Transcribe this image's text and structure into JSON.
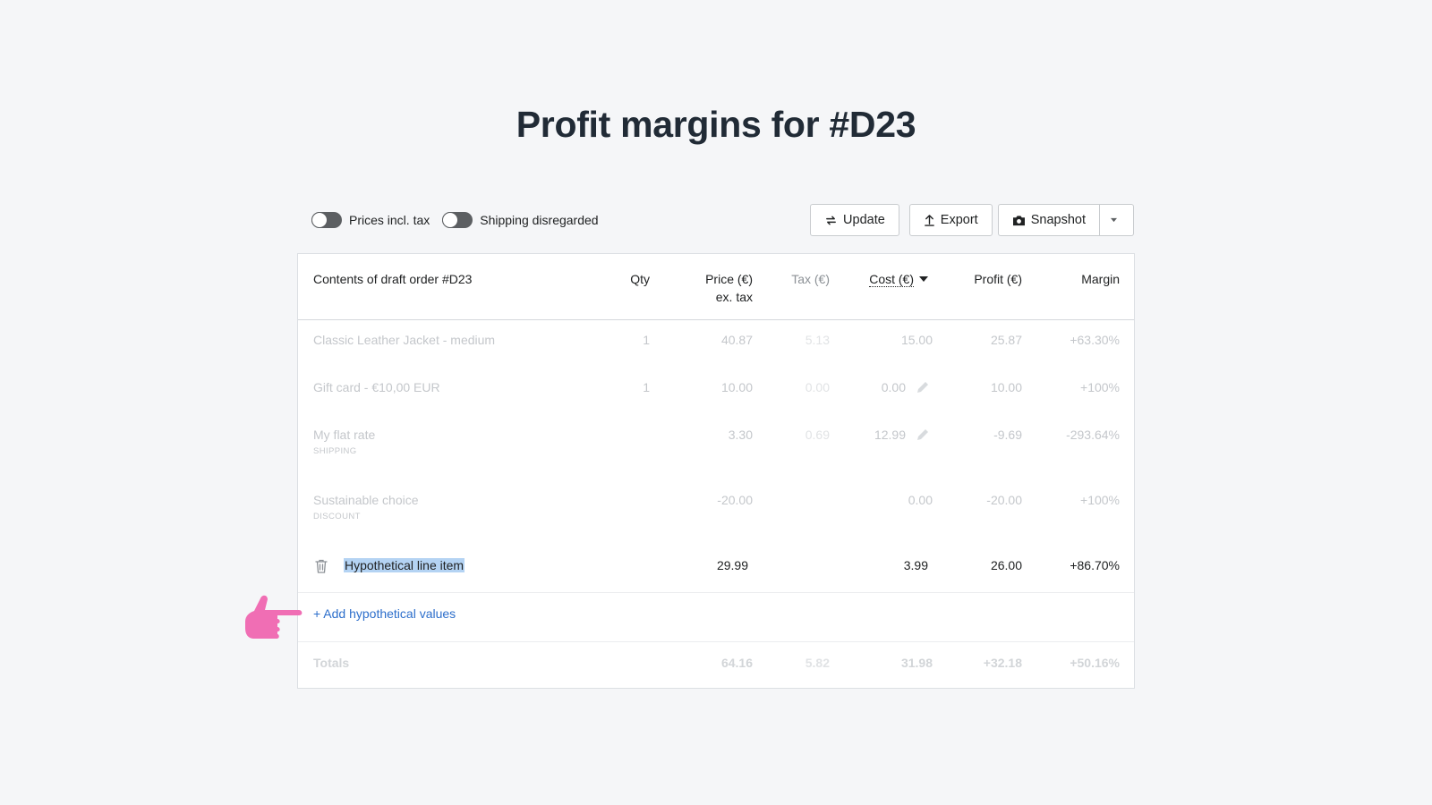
{
  "page": {
    "title": "Profit margins for #D23"
  },
  "toolbar": {
    "toggles": [
      {
        "label": "Prices incl. tax",
        "on": false
      },
      {
        "label": "Shipping disregarded",
        "on": false
      }
    ],
    "update_label": "Update",
    "export_label": "Export",
    "snapshot_label": "Snapshot"
  },
  "table": {
    "headers": {
      "item": "Contents of draft order #D23",
      "qty": "Qty",
      "price": "Price (€)",
      "price_sub": "ex. tax",
      "tax": "Tax (€)",
      "cost": "Cost (€)",
      "profit": "Profit (€)",
      "margin": "Margin"
    },
    "rows": [
      {
        "name": "Classic Leather Jacket - medium",
        "tag": "",
        "qty": "1",
        "price": "40.87",
        "tax": "5.13",
        "cost": "15.00",
        "profit": "25.87",
        "margin": "+63.30%"
      },
      {
        "name": "Gift card - €10,00 EUR",
        "tag": "",
        "qty": "1",
        "price": "10.00",
        "tax": "0.00",
        "cost": "0.00",
        "profit": "10.00",
        "margin": "+100%"
      },
      {
        "name": "My flat rate",
        "tag": "SHIPPING",
        "qty": "",
        "price": "3.30",
        "tax": "0.69",
        "cost": "12.99",
        "profit": "-9.69",
        "margin": "-293.64%"
      },
      {
        "name": "Sustainable choice",
        "tag": "DISCOUNT",
        "qty": "",
        "price": "-20.00",
        "tax": "",
        "cost": "0.00",
        "profit": "-20.00",
        "margin": "+100%"
      }
    ],
    "hypothetical": {
      "name": "Hypothetical line item",
      "price": "29.99",
      "cost": "3.99",
      "profit": "26.00",
      "margin": "+86.70%"
    },
    "add_link": "+ Add hypothetical values",
    "totals": {
      "label": "Totals",
      "price": "64.16",
      "tax": "5.82",
      "cost": "31.98",
      "profit": "+32.18",
      "margin": "+50.16%"
    }
  },
  "colors": {
    "accent": "#2c6ecb",
    "hand": "#f06eb4",
    "highlight": "#b4d3f3"
  },
  "icons": [
    "update-icon",
    "export-icon",
    "camera-icon",
    "chevron-down-icon",
    "pencil-icon",
    "trash-icon",
    "pointing-hand-icon"
  ]
}
